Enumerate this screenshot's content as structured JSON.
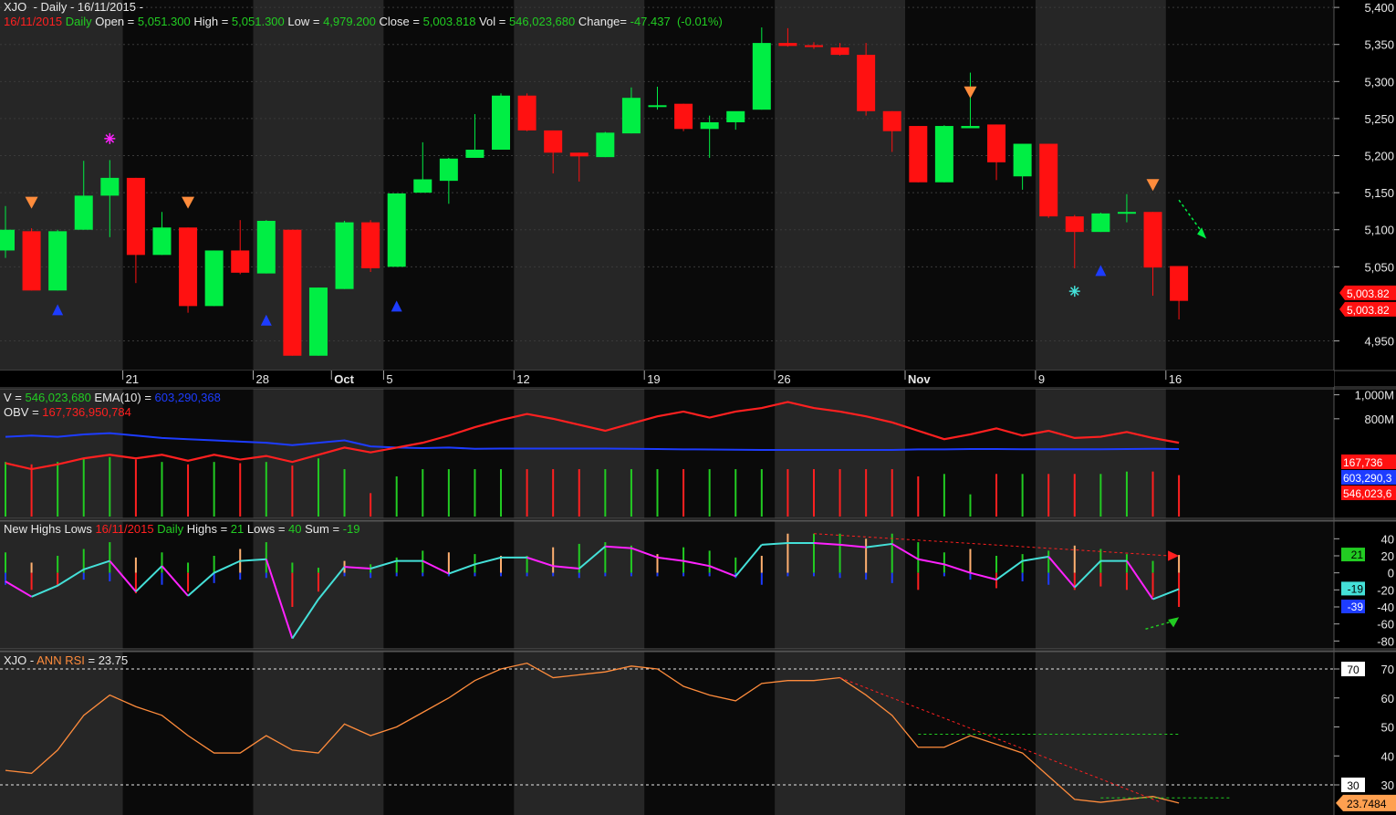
{
  "colors": {
    "up": "#00ee44",
    "down": "#ff1111",
    "green": "#22cc22",
    "red": "#ff2020",
    "blue": "#1d3cff",
    "magenta": "#ff22ff",
    "cyan": "#44e0d8",
    "orange": "#ff8c3c",
    "orange_light": "#ffb070",
    "white": "#e8e8e8",
    "grey_text": "#d0d0d0"
  },
  "header": {
    "symbol": "XJO",
    "title_rest": "  - Daily - 16/11/2015 -",
    "ohlc_date": "16/11/2015",
    "ohlc_daily": "Daily",
    "open_label": "Open = ",
    "open": "5,051.300",
    "high_label": "High = ",
    "high": "5,051.300",
    "low_label": "Low = ",
    "low": "4,979.200",
    "close_label": "Close = ",
    "close": "5,003.818",
    "vol_label": "Vol = ",
    "vol": "546,023,680",
    "change_label": "Change= ",
    "change": "-47.437  (-0.01%)"
  },
  "volume_panel": {
    "v_label": "V = ",
    "v_value": "546,023,680",
    "ema_label": "EMA(10) = ",
    "ema_value": "603,290,368",
    "obv_label": "OBV = ",
    "obv_value": "167,736,950,784"
  },
  "nhl_panel": {
    "title": "New Highs Lows",
    "date": "16/11/2015",
    "daily": "Daily",
    "highs_label": "Highs = ",
    "highs": "21",
    "lows_label": "Lows = ",
    "lows": "40",
    "sum_label": "Sum = ",
    "sum": "-19"
  },
  "rsi_panel": {
    "symbol": "XJO",
    "dash": " - ",
    "title": "ANN RSI",
    "value_label": " = ",
    "value": "23.75"
  },
  "chart_data": [
    {
      "type": "candlestick",
      "title": "XJO - Daily - 16/11/2015",
      "ylim": [
        4910,
        5410
      ],
      "y_ticks": [
        "5,400",
        "5,350",
        "5,300",
        "5,250",
        "5,200",
        "5,150",
        "5,100",
        "5,050",
        "4,950"
      ],
      "x_labels": [
        {
          "label": "21",
          "index": 5
        },
        {
          "label": "28",
          "index": 10
        },
        {
          "label": "Oct",
          "index": 13
        },
        {
          "label": "5",
          "index": 15
        },
        {
          "label": "12",
          "index": 20
        },
        {
          "label": "19",
          "index": 25
        },
        {
          "label": "26",
          "index": 30
        },
        {
          "label": "Nov",
          "index": 35
        },
        {
          "label": "9",
          "index": 40
        },
        {
          "label": "16",
          "index": 45
        }
      ],
      "candles": [
        {
          "o": 5072,
          "h": 5132,
          "l": 5062,
          "c": 5100
        },
        {
          "o": 5098,
          "h": 5102,
          "l": 5018,
          "c": 5018
        },
        {
          "o": 5018,
          "h": 5100,
          "l": 5018,
          "c": 5098
        },
        {
          "o": 5100,
          "h": 5193,
          "l": 5100,
          "c": 5146
        },
        {
          "o": 5146,
          "h": 5194,
          "l": 5090,
          "c": 5170
        },
        {
          "o": 5170,
          "h": 5170,
          "l": 5028,
          "c": 5066
        },
        {
          "o": 5066,
          "h": 5124,
          "l": 5066,
          "c": 5103
        },
        {
          "o": 5103,
          "h": 5103,
          "l": 4988,
          "c": 4997
        },
        {
          "o": 4997,
          "h": 5072,
          "l": 4997,
          "c": 5072
        },
        {
          "o": 5072,
          "h": 5113,
          "l": 5040,
          "c": 5042
        },
        {
          "o": 5041,
          "h": 5113,
          "l": 5041,
          "c": 5112
        },
        {
          "o": 5100,
          "h": 5100,
          "l": 4930,
          "c": 4930
        },
        {
          "o": 4930,
          "h": 5022,
          "l": 4930,
          "c": 5022
        },
        {
          "o": 5020,
          "h": 5112,
          "l": 5020,
          "c": 5110
        },
        {
          "o": 5110,
          "h": 5113,
          "l": 5043,
          "c": 5048
        },
        {
          "o": 5050,
          "h": 5149,
          "l": 5050,
          "c": 5149
        },
        {
          "o": 5150,
          "h": 5218,
          "l": 5150,
          "c": 5168
        },
        {
          "o": 5166,
          "h": 5197,
          "l": 5135,
          "c": 5196
        },
        {
          "o": 5197,
          "h": 5256,
          "l": 5197,
          "c": 5208
        },
        {
          "o": 5208,
          "h": 5284,
          "l": 5208,
          "c": 5281
        },
        {
          "o": 5281,
          "h": 5284,
          "l": 5233,
          "c": 5234
        },
        {
          "o": 5234,
          "h": 5234,
          "l": 5176,
          "c": 5204
        },
        {
          "o": 5204,
          "h": 5204,
          "l": 5165,
          "c": 5199
        },
        {
          "o": 5198,
          "h": 5232,
          "l": 5198,
          "c": 5231
        },
        {
          "o": 5230,
          "h": 5292,
          "l": 5230,
          "c": 5278
        },
        {
          "o": 5268,
          "h": 5293,
          "l": 5262,
          "c": 5268
        },
        {
          "o": 5270,
          "h": 5270,
          "l": 5233,
          "c": 5236
        },
        {
          "o": 5236,
          "h": 5254,
          "l": 5197,
          "c": 5245
        },
        {
          "o": 5245,
          "h": 5254,
          "l": 5235,
          "c": 5260
        },
        {
          "o": 5262,
          "h": 5373,
          "l": 5262,
          "c": 5352
        },
        {
          "o": 5352,
          "h": 5372,
          "l": 5347,
          "c": 5348
        },
        {
          "o": 5349,
          "h": 5353,
          "l": 5344,
          "c": 5348
        },
        {
          "o": 5346,
          "h": 5352,
          "l": 5335,
          "c": 5336
        },
        {
          "o": 5336,
          "h": 5352,
          "l": 5254,
          "c": 5260
        },
        {
          "o": 5260,
          "h": 5260,
          "l": 5205,
          "c": 5233
        },
        {
          "o": 5240,
          "h": 5240,
          "l": 5164,
          "c": 5164
        },
        {
          "o": 5164,
          "h": 5241,
          "l": 5164,
          "c": 5240
        },
        {
          "o": 5237,
          "h": 5312,
          "l": 5237,
          "c": 5240
        },
        {
          "o": 5242,
          "h": 5242,
          "l": 5167,
          "c": 5191
        },
        {
          "o": 5172,
          "h": 5216,
          "l": 5154,
          "c": 5216
        },
        {
          "o": 5216,
          "h": 5216,
          "l": 5116,
          "c": 5118
        },
        {
          "o": 5118,
          "h": 5120,
          "l": 5048,
          "c": 5097
        },
        {
          "o": 5097,
          "h": 5123,
          "l": 5097,
          "c": 5122
        },
        {
          "o": 5124,
          "h": 5148,
          "l": 5110,
          "c": 5124
        },
        {
          "o": 5124,
          "h": 5124,
          "l": 5011,
          "c": 5049
        },
        {
          "o": 5051,
          "h": 5051,
          "l": 4979,
          "c": 5004
        }
      ],
      "markers": [
        {
          "type": "down-triangle",
          "index": 1,
          "y": 5137,
          "color": "orange"
        },
        {
          "type": "up-triangle",
          "index": 2,
          "y": 4992,
          "color": "blue"
        },
        {
          "type": "star",
          "index": 4,
          "y": 5223,
          "color": "magenta"
        },
        {
          "type": "down-triangle",
          "index": 7,
          "y": 5137,
          "color": "orange"
        },
        {
          "type": "up-triangle",
          "index": 10,
          "y": 4978,
          "color": "blue"
        },
        {
          "type": "up-triangle",
          "index": 15,
          "y": 4997,
          "color": "blue"
        },
        {
          "type": "down-triangle",
          "index": 37,
          "y": 5286,
          "color": "orange"
        },
        {
          "type": "star",
          "index": 41,
          "y": 5017,
          "color": "cyan"
        },
        {
          "type": "up-triangle",
          "index": 42,
          "y": 5045,
          "color": "blue"
        },
        {
          "type": "down-triangle",
          "index": 44,
          "y": 5161,
          "color": "orange"
        }
      ],
      "price_labels": [
        "5,003.82",
        "5,003.82"
      ]
    },
    {
      "type": "bar+line",
      "title": "Volume / EMA(10) / OBV",
      "ylim": [
        0,
        1050
      ],
      "y_ticks": [
        "1,000M",
        "800M"
      ],
      "volume": [
        440,
        420,
        440,
        470,
        480,
        460,
        440,
        420,
        440,
        430,
        440,
        410,
        470,
        380,
        180,
        320,
        380,
        380,
        380,
        380,
        380,
        380,
        380,
        380,
        380,
        380,
        380,
        380,
        380,
        380,
        380,
        380,
        380,
        380,
        380,
        320,
        340,
        170,
        340,
        340,
        340,
        340,
        340,
        360,
        360,
        330
      ],
      "volume_color": [
        "up",
        "down",
        "up",
        "up",
        "up",
        "down",
        "up",
        "down",
        "up",
        "down",
        "up",
        "down",
        "up",
        "up",
        "down",
        "up",
        "up",
        "up",
        "up",
        "up",
        "down",
        "down",
        "down",
        "up",
        "up",
        "up",
        "down",
        "up",
        "up",
        "up",
        "down",
        "down",
        "down",
        "down",
        "down",
        "down",
        "up",
        "up",
        "down",
        "up",
        "down",
        "down",
        "up",
        "up",
        "down",
        "down"
      ],
      "ema": [
        650,
        660,
        650,
        670,
        680,
        660,
        640,
        630,
        620,
        610,
        600,
        580,
        600,
        620,
        570,
        560,
        555,
        560,
        550,
        552,
        552,
        552,
        552,
        552,
        550,
        548,
        545,
        544,
        542,
        540,
        540,
        540,
        540,
        540,
        540,
        545,
        545,
        548,
        548,
        546,
        546,
        546,
        546,
        548,
        550,
        548
      ],
      "obv": [
        430,
        380,
        420,
        470,
        500,
        470,
        500,
        450,
        500,
        460,
        490,
        440,
        500,
        560,
        520,
        560,
        600,
        660,
        730,
        790,
        840,
        800,
        750,
        700,
        760,
        820,
        860,
        810,
        860,
        890,
        940,
        890,
        860,
        820,
        770,
        700,
        630,
        670,
        720,
        660,
        700,
        640,
        650,
        690,
        640,
        600
      ],
      "values": {
        "obv": "167,736",
        "ema": "603,290,3",
        "v": "546,023,6"
      }
    },
    {
      "type": "bar+line",
      "title": "New Highs Lows",
      "ylim": [
        -85,
        50
      ],
      "y_ticks": [
        40,
        20,
        0,
        -20,
        -40,
        -60,
        -80
      ],
      "highs": [
        24,
        12,
        20,
        28,
        36,
        18,
        24,
        12,
        20,
        28,
        36,
        12,
        6,
        14,
        10,
        18,
        26,
        24,
        22,
        20,
        20,
        30,
        34,
        36,
        32,
        22,
        30,
        26,
        18,
        20,
        46,
        46,
        46,
        40,
        46,
        36,
        24,
        28,
        20,
        22,
        26,
        32,
        28,
        22,
        14,
        21
      ],
      "lows": [
        -14,
        -20,
        -16,
        -8,
        -10,
        -24,
        -14,
        -22,
        -12,
        -8,
        -6,
        -40,
        -22,
        -4,
        -6,
        -4,
        -4,
        -4,
        -4,
        -4,
        -4,
        -4,
        -6,
        -4,
        -4,
        -4,
        -4,
        -4,
        -6,
        -14,
        -4,
        -4,
        -6,
        -8,
        -12,
        -20,
        -4,
        -8,
        -18,
        -10,
        -14,
        -20,
        -16,
        -20,
        -28,
        -40
      ],
      "sum": [
        -10,
        -28,
        -15,
        4,
        14,
        -22,
        8,
        -27,
        0,
        14,
        16,
        -77,
        -31,
        7,
        5,
        14,
        14,
        -1,
        10,
        18,
        18,
        8,
        5,
        31,
        29,
        18,
        14,
        8,
        -4,
        33,
        35,
        35,
        33,
        30,
        34,
        16,
        10,
        0,
        -8,
        14,
        19,
        -17,
        14,
        14,
        -31,
        -19
      ],
      "labels": {
        "highs": "21",
        "sum": "-19",
        "lows": "-39"
      }
    },
    {
      "type": "line",
      "title": "XJO - ANN RSI",
      "ylim": [
        20,
        75
      ],
      "y_ticks": [
        "70",
        "60",
        "50",
        "40",
        "30"
      ],
      "values": [
        35,
        34,
        42,
        54,
        61,
        57,
        54,
        47,
        41,
        41,
        47,
        42,
        41,
        51,
        47,
        50,
        55,
        60,
        66,
        70,
        72,
        67,
        68,
        69,
        71,
        70,
        64,
        61,
        59,
        65,
        66,
        66,
        67,
        61,
        54,
        43,
        43,
        47,
        44,
        41,
        33,
        25,
        24,
        25,
        26,
        23.7484
      ],
      "reference_lines": [
        70,
        30
      ],
      "value_label": "23.7484"
    }
  ]
}
